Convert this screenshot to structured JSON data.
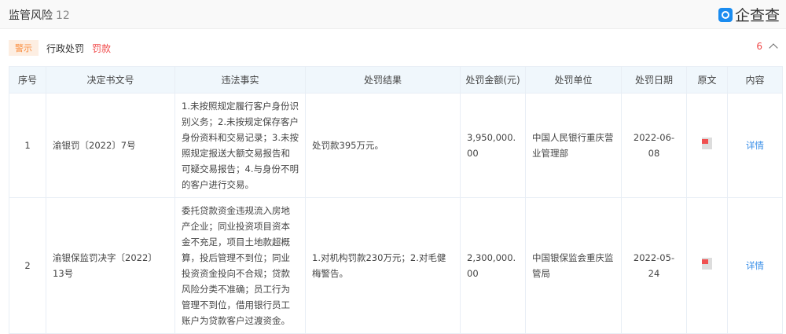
{
  "header": {
    "title": "监管风险",
    "count": "12",
    "logo_text": "企查查"
  },
  "filters": {
    "tag": "警示",
    "category": "行政处罚",
    "sub": "罚款",
    "total": "6"
  },
  "table": {
    "columns": [
      "序号",
      "决定书文号",
      "违法事实",
      "处罚结果",
      "处罚金额(元)",
      "处罚单位",
      "处罚日期",
      "原文",
      "内容"
    ],
    "rows": [
      {
        "no": "1",
        "doc": "渝银罚〔2022〕7号",
        "facts": "1.未按照规定履行客户身份识别义务；2.未按规定保存客户身份资料和交易记录；3.未按照规定报送大额交易报告和可疑交易报告；4.与身份不明的客户进行交易。",
        "result": "处罚款395万元。",
        "amount": "3,950,000.00",
        "unit": "中国人民银行重庆营业管理部",
        "date": "2022-06-08",
        "detail": "详情"
      },
      {
        "no": "2",
        "doc": "渝银保监罚决字〔2022〕13号",
        "facts": "委托贷款资金违规流入房地产企业；同业投资项目资本金不充足，项目土地款超概算，投后管理不到位；同业投资资金投向不合规；贷款风险分类不准确；员工行为管理不到位，借用银行员工账户为贷款客户过渡资金。",
        "result": "1.对机构罚款230万元；2.对毛健梅警告。",
        "amount": "2,300,000.00",
        "unit": "中国银保监会重庆监管局",
        "date": "2022-05-24",
        "detail": "详情"
      }
    ]
  }
}
